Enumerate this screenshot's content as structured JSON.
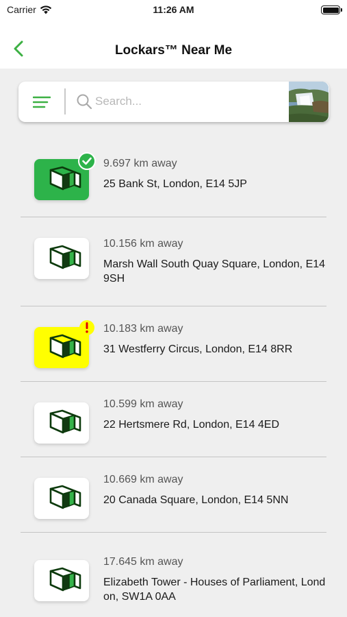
{
  "status_bar": {
    "carrier": "Carrier",
    "time": "11:26 AM"
  },
  "nav": {
    "title": "Lockars™ Near Me"
  },
  "search": {
    "placeholder": "Search..."
  },
  "colors": {
    "accent": "#3cb043",
    "tile_selected": "#2db34a",
    "tile_alert": "#ffff00",
    "tile_default": "#ffffff",
    "alert_red": "#e00000"
  },
  "lockers": [
    {
      "distance": "9.697 km away",
      "address": "25 Bank St, London, E14 5JP",
      "state": "selected"
    },
    {
      "distance": "10.156 km away",
      "address": "Marsh Wall South Quay Square, London, E14 9SH",
      "state": "default"
    },
    {
      "distance": "10.183 km away",
      "address": "31 Westferry Circus, London, E14 8RR",
      "state": "alert"
    },
    {
      "distance": "10.599 km away",
      "address": "22 Hertsmere Rd, London, E14 4ED",
      "state": "default"
    },
    {
      "distance": "10.669 km away",
      "address": "20 Canada Square, London, E14 5NN",
      "state": "default"
    },
    {
      "distance": "17.645 km away",
      "address": "Elizabeth Tower - Houses of Parliament, London, SW1A 0AA",
      "state": "default"
    }
  ]
}
